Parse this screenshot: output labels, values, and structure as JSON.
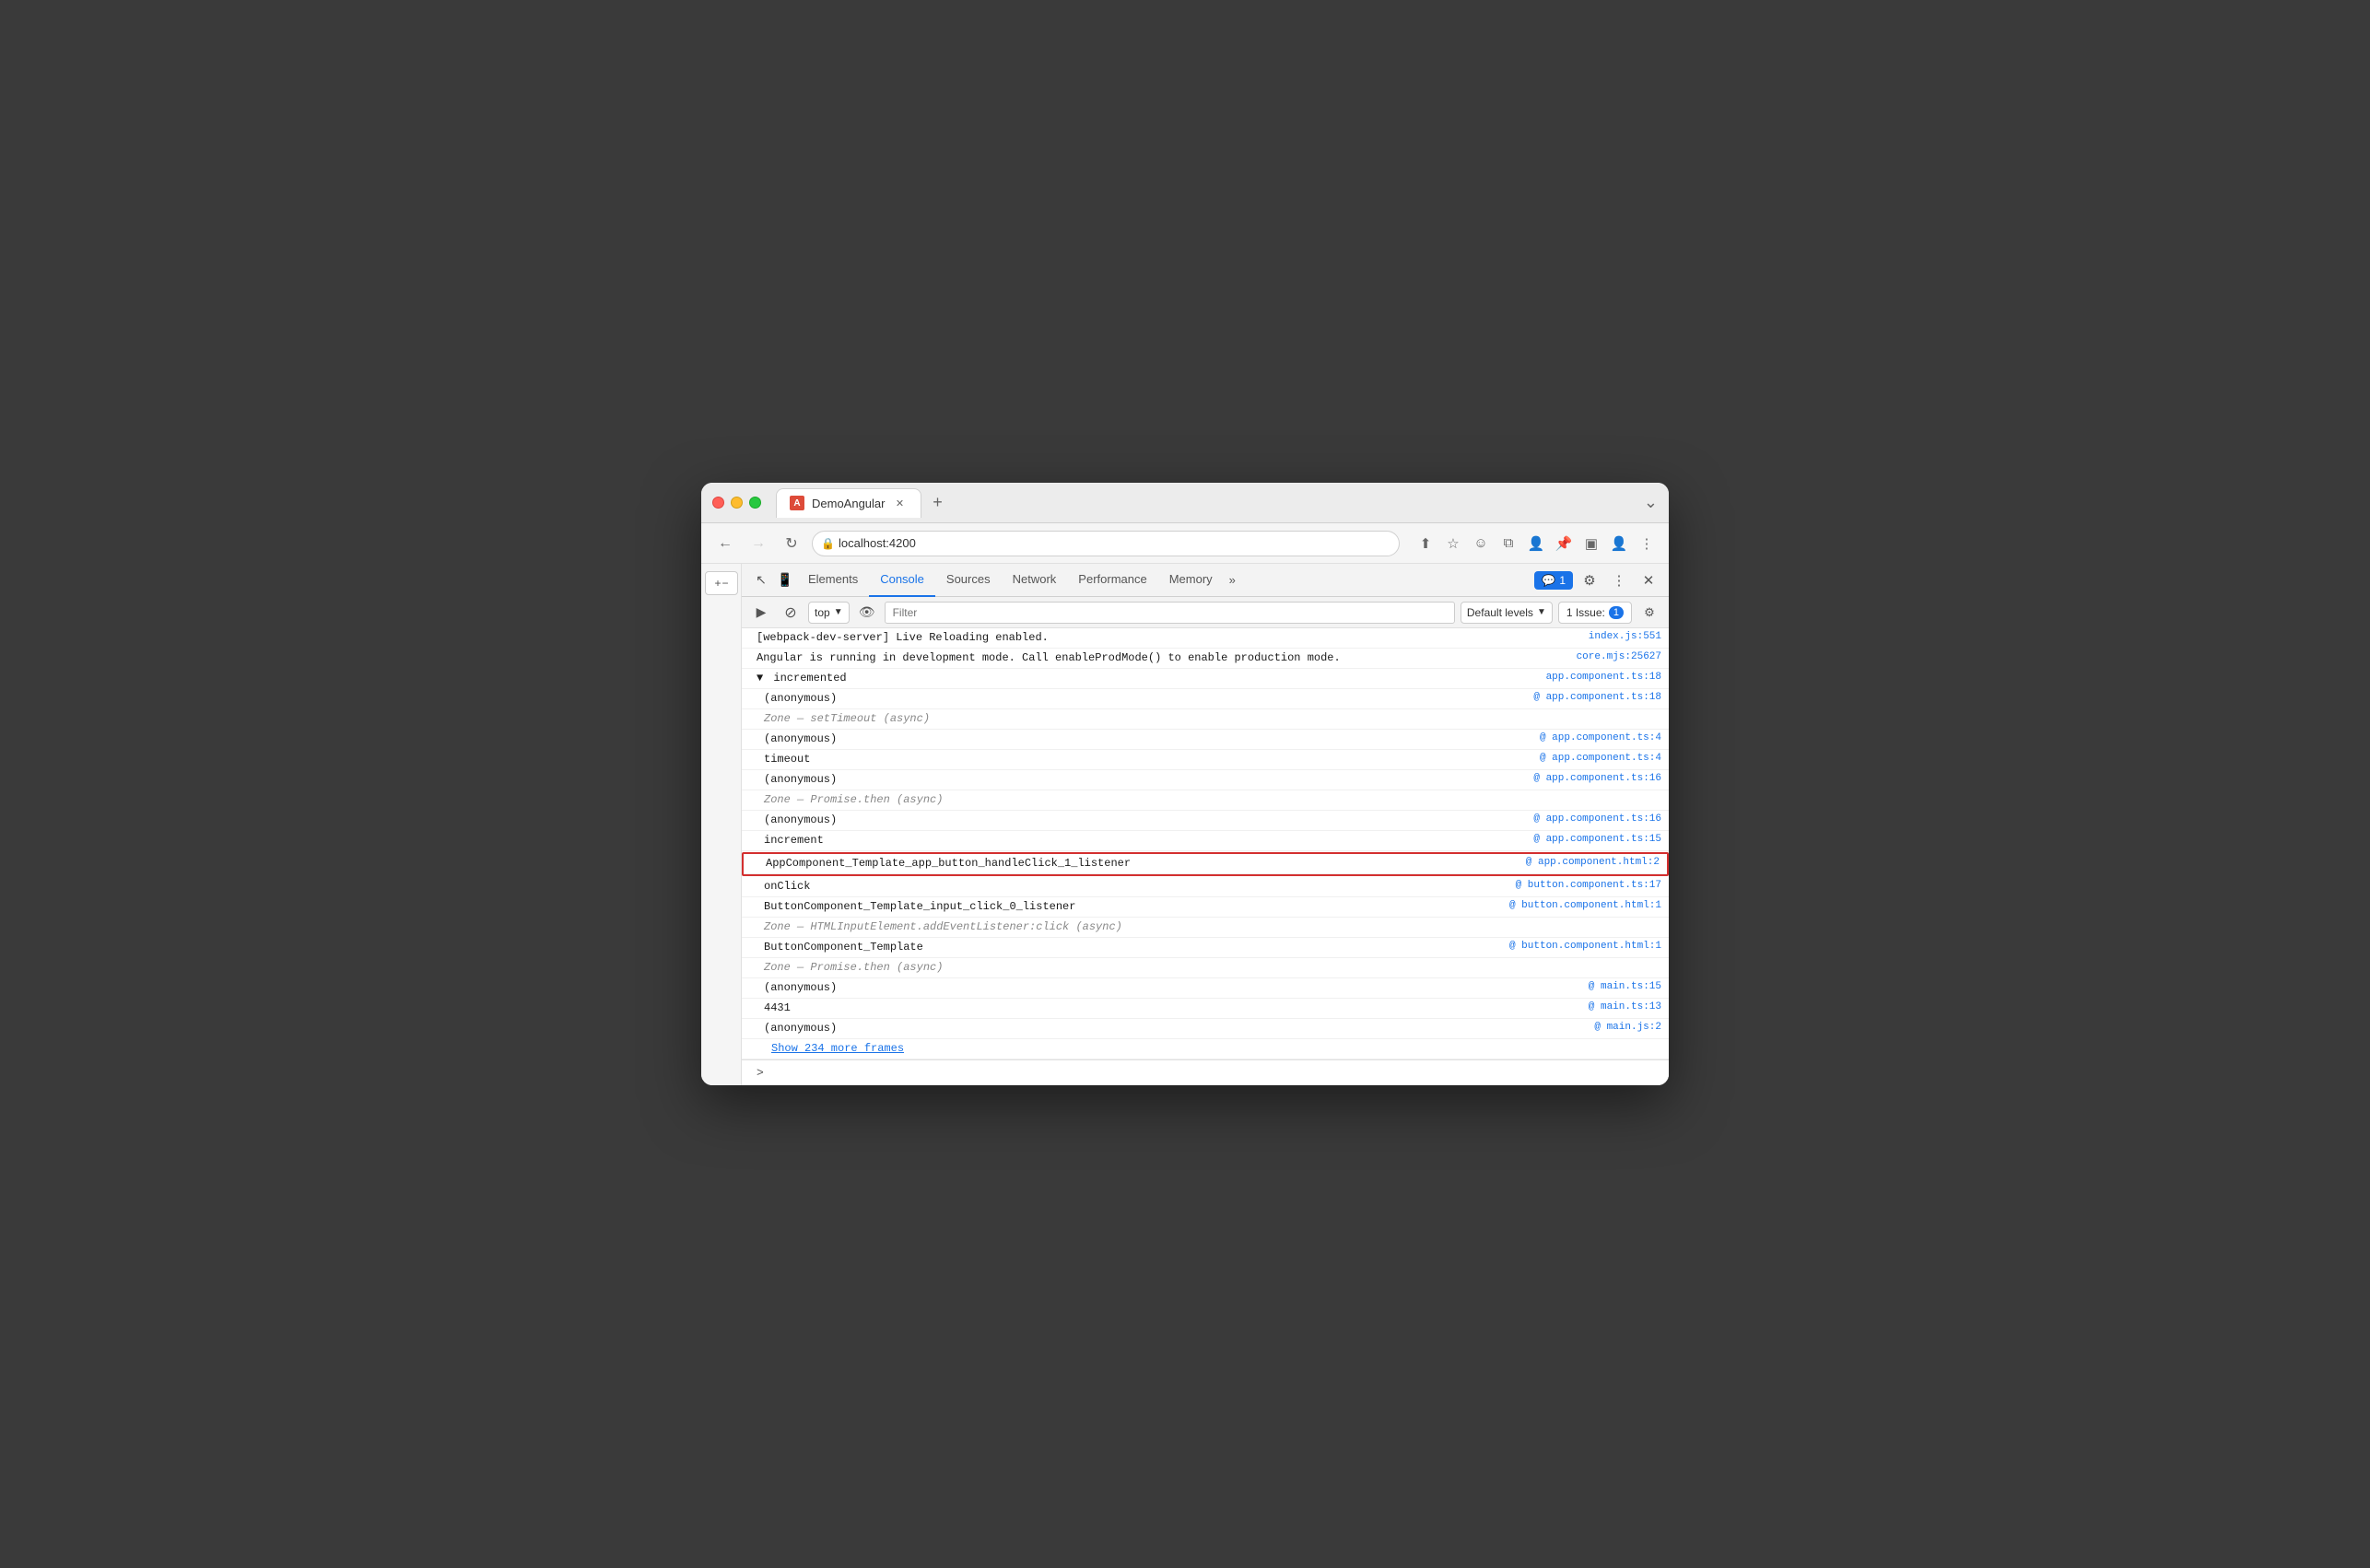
{
  "window": {
    "title": "DemoAngular"
  },
  "browser": {
    "back_disabled": false,
    "forward_disabled": true,
    "url": "localhost:4200"
  },
  "tabs": [
    {
      "label": "DemoAngular",
      "active": true,
      "favicon": "A"
    }
  ],
  "new_tab_label": "+",
  "toolbar": {
    "more_label": "⋮"
  },
  "devtools": {
    "tabs": [
      {
        "label": "Elements",
        "active": false
      },
      {
        "label": "Console",
        "active": true
      },
      {
        "label": "Sources",
        "active": false
      },
      {
        "label": "Network",
        "active": false
      },
      {
        "label": "Performance",
        "active": false
      },
      {
        "label": "Memory",
        "active": false
      }
    ],
    "more_tabs_label": "»",
    "chat_badge": "1",
    "issues_label": "1 Issue:",
    "issues_count": "1"
  },
  "console": {
    "context_label": "top",
    "filter_placeholder": "Filter",
    "levels_label": "Default levels",
    "lines": [
      {
        "id": "line1",
        "content": "[webpack-dev-server] Live Reloading enabled.",
        "source": "index.js:551",
        "indent": 0
      },
      {
        "id": "line2",
        "content": "Angular is running in development mode. Call enableProdMode() to enable production mode.",
        "source": "core.mjs:25627",
        "indent": 0
      },
      {
        "id": "line3",
        "content": "▼ incremented",
        "source": "app.component.ts:18",
        "indent": 0
      },
      {
        "id": "line4",
        "content": "  (anonymous)",
        "source": "app.component.ts:18",
        "indent": 1,
        "at": true
      },
      {
        "id": "line5",
        "content": "  Zone — setTimeout (async)",
        "indent": 1,
        "source": ""
      },
      {
        "id": "line6",
        "content": "  (anonymous)",
        "source": "app.component.ts:4",
        "indent": 1,
        "at": true
      },
      {
        "id": "line7",
        "content": "  timeout",
        "source": "app.component.ts:4",
        "indent": 1,
        "at": true
      },
      {
        "id": "line8",
        "content": "  (anonymous)",
        "source": "app.component.ts:16",
        "indent": 1,
        "at": true
      },
      {
        "id": "line9",
        "content": "  Zone — Promise.then (async)",
        "indent": 1,
        "source": ""
      },
      {
        "id": "line10",
        "content": "  (anonymous)",
        "source": "app.component.ts:16",
        "indent": 1,
        "at": true
      },
      {
        "id": "line11",
        "content": "  increment",
        "source": "app.component.ts:15",
        "indent": 1,
        "at": true
      },
      {
        "id": "line12",
        "content": "  AppComponent_Template_app_button_handleClick_1_listener",
        "source": "app.component.html:2",
        "indent": 1,
        "at": true,
        "highlighted": true
      },
      {
        "id": "line13",
        "content": "  onClick",
        "source": "button.component.ts:17",
        "indent": 1,
        "at": true
      },
      {
        "id": "line14",
        "content": "  ButtonComponent_Template_input_click_0_listener",
        "source": "button.component.html:1",
        "indent": 1,
        "at": true
      },
      {
        "id": "line15",
        "content": "  Zone — HTMLInputElement.addEventListener:click (async)",
        "indent": 1,
        "source": ""
      },
      {
        "id": "line16",
        "content": "  ButtonComponent_Template",
        "source": "button.component.html:1",
        "indent": 1,
        "at": true
      },
      {
        "id": "line17",
        "content": "  Zone — Promise.then (async)",
        "indent": 1,
        "source": ""
      },
      {
        "id": "line18",
        "content": "  (anonymous)",
        "source": "main.ts:15",
        "indent": 1,
        "at": true
      },
      {
        "id": "line19",
        "content": "  4431",
        "source": "main.ts:13",
        "indent": 1,
        "at": true
      },
      {
        "id": "line20",
        "content": "  (anonymous)",
        "source": "main.js:2",
        "indent": 1,
        "at": true
      }
    ],
    "show_more_label": "Show 234 more frames",
    "prompt_arrow": ">"
  },
  "sidebar": {
    "zoom_in": "+",
    "zoom_out": "−"
  }
}
